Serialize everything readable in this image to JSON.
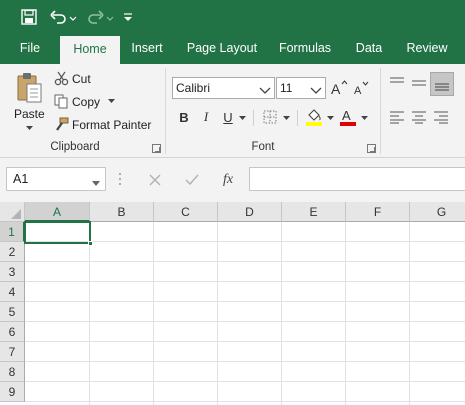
{
  "quick_access": {
    "icons": [
      "save-icon",
      "undo-icon",
      "redo-icon",
      "customize-qat-icon"
    ]
  },
  "tabs": [
    {
      "label": "File"
    },
    {
      "label": "Home"
    },
    {
      "label": "Insert"
    },
    {
      "label": "Page Layout"
    },
    {
      "label": "Formulas"
    },
    {
      "label": "Data"
    },
    {
      "label": "Review"
    }
  ],
  "active_tab": "Home",
  "clipboard": {
    "paste_label": "Paste",
    "cut_label": "Cut",
    "copy_label": "Copy",
    "format_painter_label": "Format Painter",
    "group_label": "Clipboard"
  },
  "font": {
    "family": "Calibri",
    "size": "11",
    "group_label": "Font",
    "bold_label": "B",
    "italic_label": "I",
    "underline_label": "U",
    "highlight_color": "#ffff00",
    "font_color": "#ff0000"
  },
  "formula_bar": {
    "name_box": "A1",
    "fx_label": "fx",
    "value": ""
  },
  "sheet": {
    "columns": [
      "A",
      "B",
      "C",
      "D",
      "E",
      "F",
      "G"
    ],
    "rows": [
      "1",
      "2",
      "3",
      "4",
      "5",
      "6",
      "7",
      "8",
      "9"
    ],
    "active_cell": "A1"
  },
  "colors": {
    "brand": "#217346",
    "ribbon_bg": "#f3f3f3",
    "header_bg": "#e6e6e6"
  }
}
